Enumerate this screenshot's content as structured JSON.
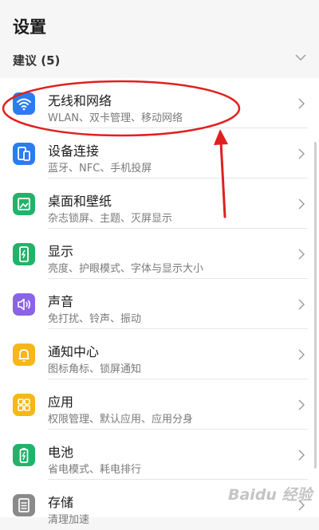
{
  "header": {
    "title": "设置"
  },
  "suggestions": {
    "label": "建议 (5)"
  },
  "items": [
    {
      "title": "无线和网络",
      "subtitle": "WLAN、双卡管理、移动网络",
      "icon": "wifi-icon",
      "color": "#2c7bf0"
    },
    {
      "title": "设备连接",
      "subtitle": "蓝牙、NFC、手机投屏",
      "icon": "device-connect-icon",
      "color": "#2c7bf0"
    },
    {
      "title": "桌面和壁纸",
      "subtitle": "杂志锁屏、主题、灭屏显示",
      "icon": "wallpaper-icon",
      "color": "#22b36b"
    },
    {
      "title": "显示",
      "subtitle": "亮度、护眼模式、字体与显示大小",
      "icon": "display-icon",
      "color": "#22b36b"
    },
    {
      "title": "声音",
      "subtitle": "免打扰、铃声、振动",
      "icon": "sound-icon",
      "color": "#8a63e6"
    },
    {
      "title": "通知中心",
      "subtitle": "图标角标、锁屏通知",
      "icon": "bell-icon",
      "color": "#f6b71a"
    },
    {
      "title": "应用",
      "subtitle": "权限管理、默认应用、应用分身",
      "icon": "apps-icon",
      "color": "#f6b71a"
    },
    {
      "title": "电池",
      "subtitle": "省电模式、耗电排行",
      "icon": "battery-icon",
      "color": "#22b36b"
    },
    {
      "title": "存储",
      "subtitle": "清理加速",
      "icon": "storage-icon",
      "color": "#8a8a8a"
    }
  ],
  "annotation": {
    "color": "#e02020"
  },
  "watermark": {
    "text": "Baidu 经验"
  }
}
